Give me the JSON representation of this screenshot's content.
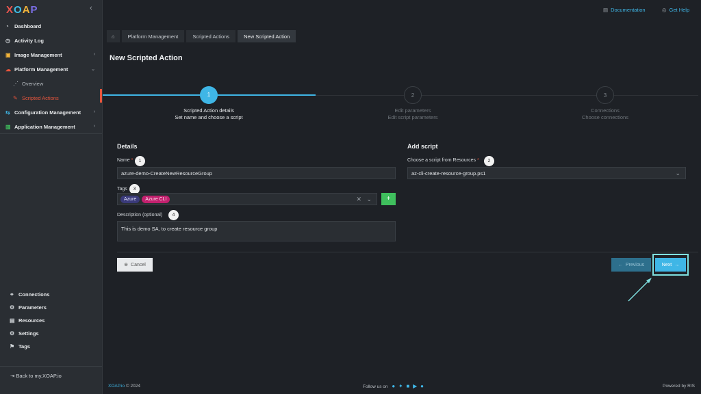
{
  "app": {
    "logo": "XOAP",
    "footer_brand": "XOAP.io",
    "footer_year": "© 2024",
    "follow": "Follow us on",
    "powered": "Powered by RIS"
  },
  "top": {
    "documentation": "Documentation",
    "help": "Get Help"
  },
  "sidebar": {
    "items": [
      {
        "label": "Dashboard",
        "icon": "dashboard-icon"
      },
      {
        "label": "Activity Log",
        "icon": "clock-icon"
      },
      {
        "label": "Image Management",
        "icon": "image-icon"
      },
      {
        "label": "Platform Management",
        "icon": "cloud-icon"
      },
      {
        "label": "Overview",
        "icon": "overview-icon"
      },
      {
        "label": "Scripted Actions",
        "icon": "script-icon"
      },
      {
        "label": "Configuration Management",
        "icon": "config-icon"
      },
      {
        "label": "Application Management",
        "icon": "app-icon"
      }
    ],
    "bottom": [
      {
        "label": "Connections",
        "icon": "link-icon"
      },
      {
        "label": "Parameters",
        "icon": "parameters-icon"
      },
      {
        "label": "Resources",
        "icon": "resources-icon"
      },
      {
        "label": "Settings",
        "icon": "gear-icon"
      },
      {
        "label": "Tags",
        "icon": "tag-icon"
      }
    ],
    "back": "Back to my.XOAP.io"
  },
  "breadcrumb": [
    "Platform Management",
    "Scripted Actions",
    "New Scripted Action"
  ],
  "page_title": "New Scripted Action",
  "steps": [
    {
      "num": "1",
      "title": "Scripted Action details",
      "subtitle": "Set name and choose a script",
      "active": true
    },
    {
      "num": "2",
      "title": "Edit parameters",
      "subtitle": "Edit script parameters",
      "active": false
    },
    {
      "num": "3",
      "title": "Connections",
      "subtitle": "Choose connections",
      "active": false
    }
  ],
  "details": {
    "heading": "Details",
    "name_label": "Name",
    "name_value": "azure-demo-CreateNewResourceGroup",
    "tags_label": "Tags",
    "tags": [
      "Azure",
      "Azure CLI"
    ],
    "desc_label": "Description (optional)",
    "desc_value": "This is demo SA, to create resource group"
  },
  "add_script": {
    "heading": "Add script",
    "choose_label": "Choose a script from Resources",
    "value": "az-cli-create-resource-group.ps1"
  },
  "annotations": [
    "1",
    "2",
    "3",
    "4"
  ],
  "buttons": {
    "cancel": "Cancel",
    "previous": "Previous",
    "next": "Next"
  },
  "colors": {
    "accent": "#3fb6e6",
    "active_nav": "#e8553c",
    "add": "#3fbf5d"
  }
}
